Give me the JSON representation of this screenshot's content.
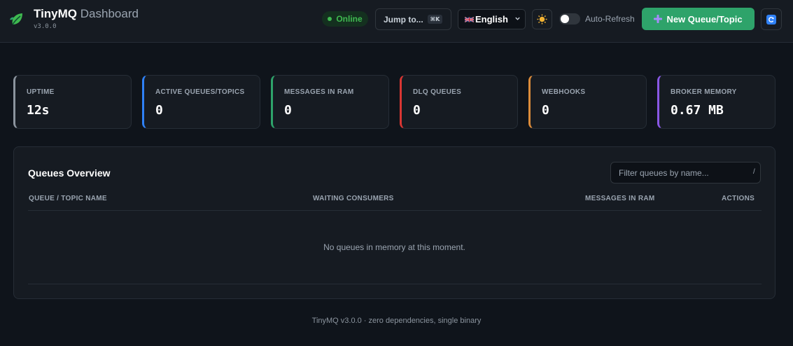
{
  "header": {
    "brand": "TinyMQ",
    "brand_suffix": "Dashboard",
    "version": "v3.0.0",
    "status": "Online",
    "jump_label": "Jump to...",
    "jump_shortcut": "⌘K",
    "language": "English",
    "auto_refresh_label": "Auto-Refresh",
    "new_button_label": "New Queue/Topic",
    "icons": {
      "logo": "leaf-icon",
      "flag": "uk-flag-icon",
      "theme": "sun-icon",
      "new": "plus-icon",
      "refresh": "refresh-icon"
    }
  },
  "stats": [
    {
      "label": "UPTIME",
      "value": "12s",
      "accent": "#8b949e"
    },
    {
      "label": "ACTIVE QUEUES/TOPICS",
      "value": "0",
      "accent": "#2f81f7"
    },
    {
      "label": "MESSAGES IN RAM",
      "value": "0",
      "accent": "#2ea36a"
    },
    {
      "label": "DLQ QUEUES",
      "value": "0",
      "accent": "#da3633"
    },
    {
      "label": "WEBHOOKS",
      "value": "0",
      "accent": "#db8b3a"
    },
    {
      "label": "BROKER MEMORY",
      "value": "0.67 MB",
      "accent": "#8957e5"
    }
  ],
  "queues": {
    "title": "Queues Overview",
    "filter_placeholder": "Filter queues by name...",
    "filter_shortcut": "/",
    "columns": [
      "QUEUE / TOPIC NAME",
      "WAITING CONSUMERS",
      "MESSAGES IN RAM",
      "ACTIONS"
    ],
    "empty_message": "No queues in memory at this moment."
  },
  "footer": "TinyMQ v3.0.0 · zero dependencies, single binary",
  "colors": {
    "accent_green": "#2ea36a",
    "status_green": "#3fb950",
    "background": "#0f141b",
    "panel": "#161b22"
  }
}
